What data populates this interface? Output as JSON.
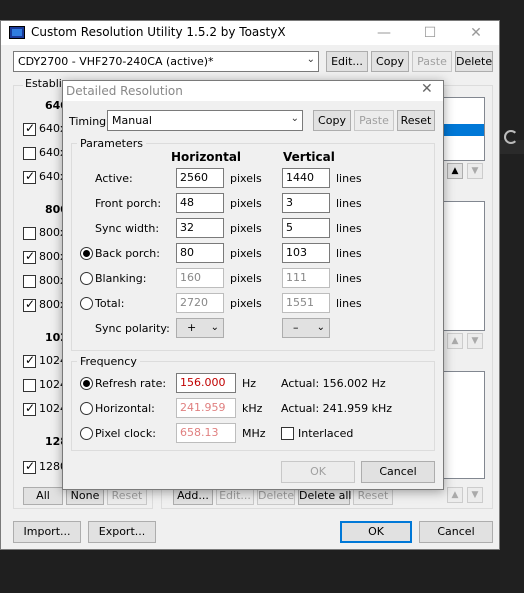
{
  "window": {
    "title": "Custom Resolution Utility 1.5.2 by ToastyX",
    "minimize": "—",
    "maximize": "☐",
    "close": "✕"
  },
  "monitor": {
    "selected": "CDY2700 - VHF270-240CA (active)*"
  },
  "top_buttons": {
    "edit": "Edit...",
    "copy": "Copy",
    "paste": "Paste",
    "delete": "Delete"
  },
  "established": {
    "label": "Establi",
    "header_640": "640",
    "header_800": "800",
    "header_1024": "102",
    "header_1280": "128",
    "items": [
      {
        "text": "640x",
        "checked": true
      },
      {
        "text": "640x",
        "checked": false
      },
      {
        "text": "640x",
        "checked": true
      },
      {
        "text": "800x",
        "checked": false
      },
      {
        "text": "800x",
        "checked": true
      },
      {
        "text": "800x",
        "checked": false
      },
      {
        "text": "800x",
        "checked": true
      },
      {
        "text": "1024",
        "checked": true
      },
      {
        "text": "1024",
        "checked": false
      },
      {
        "text": "1024",
        "checked": true
      },
      {
        "text": "1280",
        "checked": true
      }
    ],
    "all": "All",
    "none": "None",
    "reset": "Reset"
  },
  "detailed_buttons": {
    "add": "Add...",
    "edit": "Edit...",
    "delete": "Delete",
    "delete_all": "Delete all",
    "reset": "Reset"
  },
  "bottom": {
    "import": "Import...",
    "export": "Export...",
    "ok": "OK",
    "cancel": "Cancel"
  },
  "dialog": {
    "title": "Detailed Resolution",
    "close": "✕",
    "timing_label": "Timing:",
    "timing_value": "Manual",
    "copy": "Copy",
    "paste": "Paste",
    "reset": "Reset",
    "parameters_label": "Parameters",
    "horizontal_header": "Horizontal",
    "vertical_header": "Vertical",
    "rows": [
      {
        "label": "Active:",
        "h": "2560",
        "h_unit": "pixels",
        "v": "1440",
        "v_unit": "lines",
        "disabled": false,
        "radio": false
      },
      {
        "label": "Front porch:",
        "h": "48",
        "h_unit": "pixels",
        "v": "3",
        "v_unit": "lines",
        "disabled": false,
        "radio": false
      },
      {
        "label": "Sync width:",
        "h": "32",
        "h_unit": "pixels",
        "v": "5",
        "v_unit": "lines",
        "disabled": false,
        "radio": false
      },
      {
        "label": "Back porch:",
        "h": "80",
        "h_unit": "pixels",
        "v": "103",
        "v_unit": "lines",
        "disabled": false,
        "radio": true,
        "selected": true
      },
      {
        "label": "Blanking:",
        "h": "160",
        "h_unit": "pixels",
        "v": "111",
        "v_unit": "lines",
        "disabled": true,
        "radio": true,
        "selected": false
      },
      {
        "label": "Total:",
        "h": "2720",
        "h_unit": "pixels",
        "v": "1551",
        "v_unit": "lines",
        "disabled": true,
        "radio": true,
        "selected": false
      }
    ],
    "sync_polarity_label": "Sync polarity:",
    "h_polarity": "+",
    "v_polarity": "–",
    "frequency_label": "Frequency",
    "refresh_label": "Refresh rate:",
    "refresh_value": "156.000",
    "refresh_unit": "Hz",
    "refresh_actual": "Actual: 156.002 Hz",
    "horizontal_label": "Horizontal:",
    "horizontal_value": "241.959",
    "horizontal_unit": "kHz",
    "horizontal_actual": "Actual: 241.959 kHz",
    "pixel_clock_label": "Pixel clock:",
    "pixel_clock_value": "658.13",
    "pixel_clock_unit": "MHz",
    "interlaced_label": "Interlaced",
    "ok": "OK",
    "cancel": "Cancel"
  }
}
